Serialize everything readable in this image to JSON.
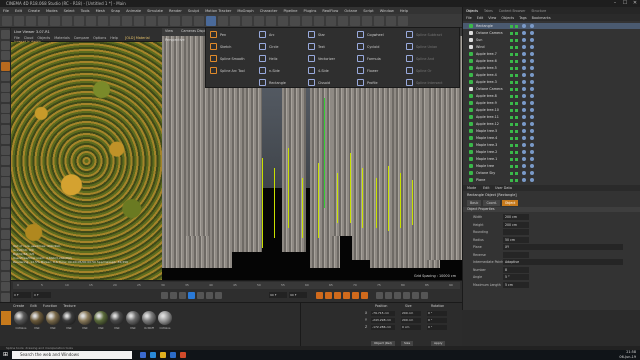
{
  "window": {
    "title": "CINEMA 4D R18.068 Studio (RC - R18) - [Untitled 1 *] - Main",
    "min": "–",
    "max": "☐",
    "close": "✕"
  },
  "menubar": [
    "File",
    "Edit",
    "Create",
    "Modes",
    "Select",
    "Tools",
    "Mesh",
    "Snap",
    "Animate",
    "Simulate",
    "Render",
    "Sculpt",
    "Motion Tracker",
    "MoGraph",
    "Character",
    "Pipeline",
    "Plugins",
    "RealFlow",
    "Octane",
    "Script",
    "Window",
    "Help"
  ],
  "layout": {
    "label": "Layout:",
    "value": "Startup"
  },
  "renderview": {
    "title": "Live Viewer 3.07-R1",
    "menu": [
      "File",
      "Cloud",
      "Objects",
      "Materials",
      "Compare",
      "Options",
      "Help"
    ],
    "material_tag": "[OLD] Material (preset is darkb...",
    "stats": [
      "Out of core used/max: 0Kb/4Gb",
      "Grey8/16: 0/0",
      "Rgb32/64: 0/0",
      "Used/free/total vram: 4.6Gb/3.2Gb/8Gb",
      "Rendering: 12.5%  Ms/sec: 6.6  Time: 00:00:05/00:00:50  Spp/maxspp: 32/256"
    ]
  },
  "viewport": {
    "menu": [
      "View",
      "Cameras",
      "Display",
      "Options",
      "Filter",
      "Panel",
      "ProRender"
    ],
    "label": "Perspective",
    "grid_spacing": "Grid Spacing : 10000 cm"
  },
  "spline_menu": {
    "col1": [
      "Pen",
      "Sketch",
      "Spline Smooth",
      "Spline Arc Tool"
    ],
    "col2": [
      "Arc",
      "Circle",
      "Helix",
      "n-Side",
      "Rectangle"
    ],
    "col3": [
      "Star",
      "Text",
      "Vectorizer",
      "4-Side",
      "Cissoid"
    ],
    "col4": [
      "Cogwheel",
      "Cycloid",
      "Formula",
      "Flower",
      "Profile"
    ],
    "col5": [
      "Spline Subtract",
      "Spline Union",
      "Spline And",
      "Spline Or",
      "Spline Intersect"
    ]
  },
  "objects": {
    "tabs": [
      "Objects",
      "Takes",
      "Content Browser",
      "Structure"
    ],
    "menu": [
      "File",
      "Edit",
      "View",
      "Objects",
      "Tags",
      "Bookmarks"
    ],
    "items": [
      "Rectangle",
      "Octane Camera",
      "Sun",
      "Wind",
      "Apple tree.7",
      "Apple tree.6",
      "Apple tree.5",
      "Apple tree.4",
      "Apple tree.3",
      "Octane Camera",
      "Apple tree.8",
      "Apple tree.9",
      "Apple tree.10",
      "Apple tree.11",
      "Apple tree.12",
      "Maple tree.5",
      "Maple tree.4",
      "Maple tree.3",
      "Maple tree.2",
      "Maple tree.1",
      "Maple tree",
      "Octane Sky",
      "Plane"
    ]
  },
  "attributes": {
    "menu": [
      "Mode",
      "Edit",
      "User Data"
    ],
    "title": "Rectangle Object [Rectangle]",
    "tabs": [
      "Basic",
      "Coord.",
      "Object"
    ],
    "section": "Object Properties",
    "props": [
      {
        "label": "Width",
        "value": "200 cm"
      },
      {
        "label": "Height",
        "value": "200 cm"
      },
      {
        "label": "Rounding",
        "value": ""
      },
      {
        "label": "Radius",
        "value": "50 cm"
      },
      {
        "label": "Plane",
        "value": "XY"
      },
      {
        "label": "Reverse",
        "value": ""
      },
      {
        "label": "Intermediate Points",
        "value": "Adaptive"
      },
      {
        "label": "Number",
        "value": "8"
      },
      {
        "label": "Angle",
        "value": "5 °"
      },
      {
        "label": "Maximum Length",
        "value": "5 cm"
      }
    ]
  },
  "timeline": {
    "ticks": [
      "0",
      "5",
      "10",
      "15",
      "20",
      "25",
      "30",
      "35",
      "40",
      "45",
      "50",
      "55",
      "60",
      "65",
      "70",
      "75",
      "80",
      "85",
      "90"
    ],
    "start": "0 F",
    "current": "0 F",
    "end": "90 F",
    "end2": "90 F"
  },
  "materials": {
    "menu": [
      "Create",
      "Edit",
      "Function",
      "Texture"
    ],
    "items": [
      {
        "label": "OctGlos",
        "color": "#5a5a5a"
      },
      {
        "label": "Mat",
        "color": "#6b5a3a"
      },
      {
        "label": "Mat",
        "color": "#7a6a4a"
      },
      {
        "label": "Mat",
        "color": "#3a3a3a"
      },
      {
        "label": "Mat",
        "color": "#8a7a5a"
      },
      {
        "label": "Mat",
        "color": "#5a6a3a"
      },
      {
        "label": "Mat",
        "color": "#4a4a4a"
      },
      {
        "label": "Mat",
        "color": "#6a6a6a"
      },
      {
        "label": "OctDiff",
        "color": "#7c7c7c"
      },
      {
        "label": "OctGlos",
        "color": "#9a9a9a"
      }
    ]
  },
  "coordinates": {
    "headers": [
      "Position",
      "Size",
      "Rotation"
    ],
    "rows": [
      {
        "axis": "X",
        "pos": "-79.715 cm",
        "size": "200 cm",
        "rot": "0 °",
        "rot_axis": "H"
      },
      {
        "axis": "Y",
        "pos": "-243.298 cm",
        "size": "200 cm",
        "rot": "0 °",
        "rot_axis": "P"
      },
      {
        "axis": "Z",
        "pos": "-172.286 cm",
        "size": "0 cm",
        "rot": "0 °",
        "rot_axis": "B"
      }
    ],
    "mode": "Object (Rel)",
    "size_mode": "Size",
    "apply": "Apply"
  },
  "status": "Spline tools: drawing and manipulation tools",
  "taskbar": {
    "search_placeholder": "Search the web and Windows",
    "time": "21:58",
    "date": "06-Jun-19"
  }
}
